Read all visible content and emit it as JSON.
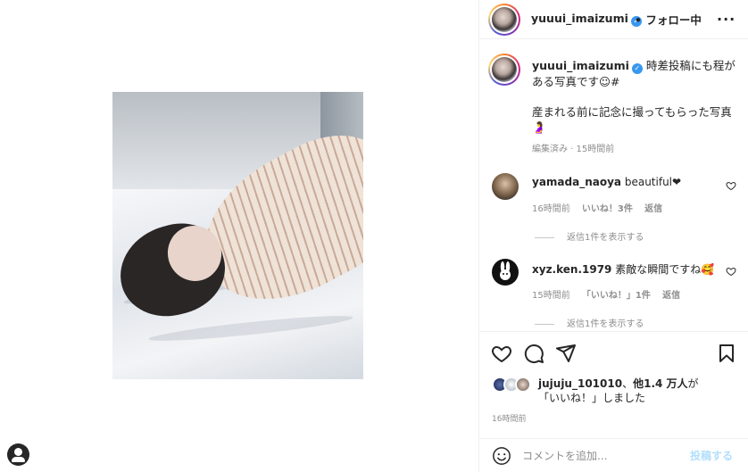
{
  "post": {
    "image_alt_icon": "photo",
    "author": {
      "username": "yuuui_imaizumi",
      "verified_icon": "verified-badge-icon",
      "follow_status": "• フォロー中"
    },
    "more_icon": "more-options-icon",
    "caption": {
      "username": "yuuui_imaizumi",
      "text_line1": " 時差投稿にも程がある写真です☺︎#",
      "text_line2": "産まれる前に記念に撮ってもらった写真🤰",
      "meta": "編集済み · 15時間前"
    },
    "comments": [
      {
        "username": "yamada_naoya",
        "text": "beautiful❤",
        "time": "16時間前",
        "likes": "いいね！3件",
        "reply": "返信",
        "view_replies": "返信1件を表示する"
      },
      {
        "username": "xyz.ken.1979",
        "text": "素敵な瞬間ですね🥰",
        "time": "15時間前",
        "likes": "「いいね！」1件",
        "reply": "返信",
        "view_replies": "返信1件を表示する"
      }
    ],
    "likes": {
      "liker": "jujuju_101010",
      "others_prefix": "、",
      "others": "他1.4 万人",
      "suffix": "が「いいね！」しました"
    },
    "posted_time": "16時間前",
    "add_comment": {
      "placeholder": "コメントを追加...",
      "post_label": "投稿する"
    }
  },
  "colors": {
    "verified": "#3897f0",
    "muted_text": "#8e8e8e",
    "post_button_disabled": "#b2dffc",
    "border": "#efefef"
  }
}
